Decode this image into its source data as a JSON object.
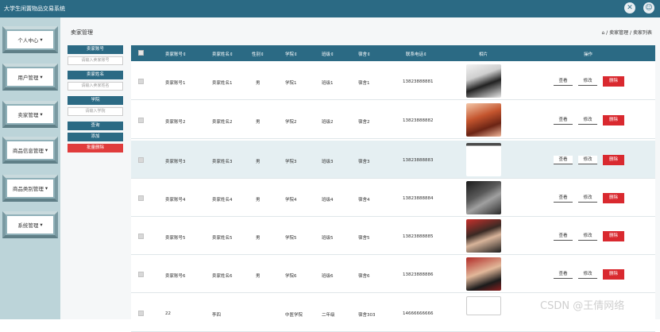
{
  "app_title": "大学生闲置物品交易系统",
  "sidebar": {
    "items": [
      {
        "label": "个人中心"
      },
      {
        "label": "用户管理"
      },
      {
        "label": "卖家管理"
      },
      {
        "label": "商品信息管理"
      },
      {
        "label": "商品类别管理"
      },
      {
        "label": "系统管理"
      }
    ]
  },
  "page": {
    "title": "卖家管理",
    "breadcrumb": [
      "卖家管理",
      "卖家列表"
    ],
    "breadcrumb_sep": " / "
  },
  "search": {
    "account_label": "卖家账号",
    "account_placeholder": "请输入卖家账号",
    "name_label": "卖家姓名",
    "name_placeholder": "请输入卖家姓名",
    "college_label": "学院",
    "college_placeholder": "请输入学院",
    "query_button": "查询",
    "add_button": "添加",
    "batch_delete_button": "批量删除"
  },
  "table": {
    "headers": [
      "卖家账号⇕",
      "卖家姓名⇕",
      "性别⇕",
      "学院⇕",
      "班级⇕",
      "宿舍⇕",
      "联系电话⇕",
      "相片",
      "操作"
    ],
    "rows": [
      {
        "account": "卖家账号1",
        "name": "卖家姓名1",
        "gender": "男",
        "college": "学院1",
        "class": "班级1",
        "dorm": "宿舍1",
        "phone": "13823888881"
      },
      {
        "account": "卖家账号2",
        "name": "卖家姓名2",
        "gender": "男",
        "college": "学院2",
        "class": "班级2",
        "dorm": "宿舍2",
        "phone": "13823888882"
      },
      {
        "account": "卖家账号3",
        "name": "卖家姓名3",
        "gender": "男",
        "college": "学院3",
        "class": "班级3",
        "dorm": "宿舍3",
        "phone": "13823888883"
      },
      {
        "account": "卖家账号4",
        "name": "卖家姓名4",
        "gender": "男",
        "college": "学院4",
        "class": "班级4",
        "dorm": "宿舍4",
        "phone": "13823888884"
      },
      {
        "account": "卖家账号5",
        "name": "卖家姓名5",
        "gender": "男",
        "college": "学院5",
        "class": "班级5",
        "dorm": "宿舍5",
        "phone": "13823888885"
      },
      {
        "account": "卖家账号6",
        "name": "卖家姓名6",
        "gender": "男",
        "college": "学院6",
        "class": "班级6",
        "dorm": "宿舍6",
        "phone": "13823888886"
      },
      {
        "account": "22",
        "name": "李四",
        "gender": "",
        "college": "中医学院",
        "class": "二年级",
        "dorm": "宿舍303",
        "phone": "14666666666"
      }
    ],
    "actions": {
      "view": "查看",
      "edit": "修改",
      "delete": "删除"
    }
  },
  "watermark": "CSDN @王倩网络",
  "colors": {
    "header": "#2b6a84",
    "sidebar": "#bcd4d9",
    "delete": "#d9292f",
    "highlight_row": "#e5eff2"
  }
}
